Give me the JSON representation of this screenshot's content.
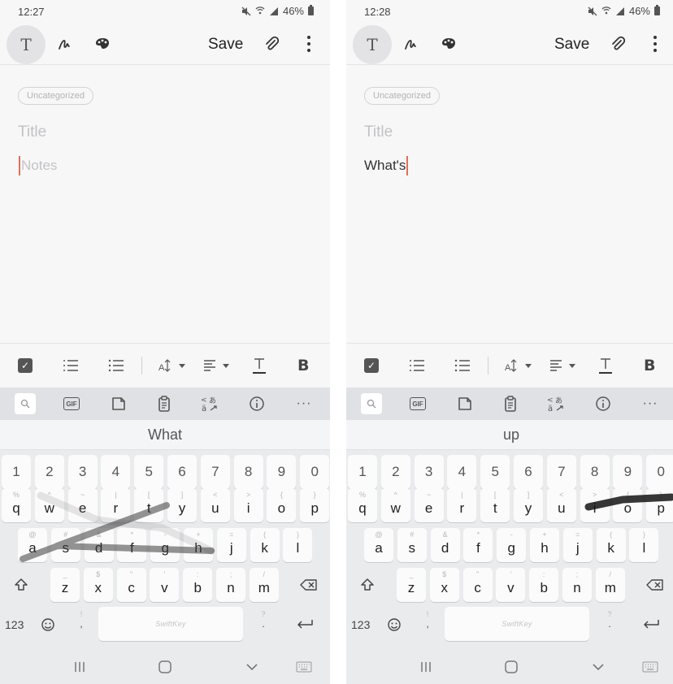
{
  "screens": [
    {
      "status": {
        "time": "12:27",
        "battery": "46%"
      },
      "toolbar": {
        "text_mode": "T",
        "save_label": "Save"
      },
      "note": {
        "category": "Uncategorized",
        "title_placeholder": "Title",
        "body": "Notes"
      },
      "format": {
        "bold": "B"
      },
      "keyboard": {
        "suggestion": "What",
        "brand": "SwiftKey",
        "mode_label": "123"
      }
    },
    {
      "status": {
        "time": "12:28",
        "battery": "46%"
      },
      "toolbar": {
        "text_mode": "T",
        "save_label": "Save"
      },
      "note": {
        "category": "Uncategorized",
        "title_placeholder": "Title",
        "body": "What's"
      },
      "format": {
        "bold": "B"
      },
      "keyboard": {
        "suggestion": "up",
        "brand": "SwiftKey",
        "mode_label": "123"
      }
    }
  ],
  "keys": {
    "numbers": [
      "1",
      "2",
      "3",
      "4",
      "5",
      "6",
      "7",
      "8",
      "9",
      "0"
    ],
    "row1": [
      "q",
      "w",
      "e",
      "r",
      "t",
      "y",
      "u",
      "i",
      "o",
      "p"
    ],
    "row1_hints": [
      "%",
      "^",
      "~",
      "|",
      "[",
      "]",
      "<",
      ">",
      "{",
      "}"
    ],
    "row2": [
      "a",
      "s",
      "d",
      "f",
      "g",
      "h",
      "j",
      "k",
      "l"
    ],
    "row2_hints": [
      "@",
      "#",
      "&",
      "*",
      "-",
      "+",
      "=",
      "(",
      ")"
    ],
    "row3": [
      "z",
      "x",
      "c",
      "v",
      "b",
      "n",
      "m"
    ],
    "row3_hints": [
      "_",
      "$",
      "\"",
      "'",
      ":",
      ";",
      "/"
    ]
  },
  "punct": {
    "comma": ",",
    "comma_hint": "!",
    "period": ".",
    "period_hint": "?"
  },
  "icons": {
    "status": [
      "mute-icon",
      "wifi-icon",
      "signal-icon",
      "battery-icon"
    ],
    "toolbar": [
      "text-mode-icon",
      "handwriting-icon",
      "palette-icon",
      "attach-icon",
      "more-icon"
    ],
    "format": [
      "checkbox-icon",
      "numbered-list-icon",
      "bullet-list-icon",
      "font-size-icon",
      "align-icon",
      "text-color-icon",
      "bold-icon"
    ],
    "keyboard_tools": [
      "search-icon",
      "gif-icon",
      "sticker-icon",
      "clipboard-icon",
      "translate-icon",
      "info-icon",
      "more-dots-icon"
    ],
    "nav": [
      "recents-icon",
      "home-icon",
      "back-icon",
      "keyboard-switch-icon"
    ]
  },
  "colors": {
    "caret": "#e0705c",
    "background": "#f7f7f8",
    "keyboard": "#eaebed",
    "key": "#fbfbfc"
  }
}
